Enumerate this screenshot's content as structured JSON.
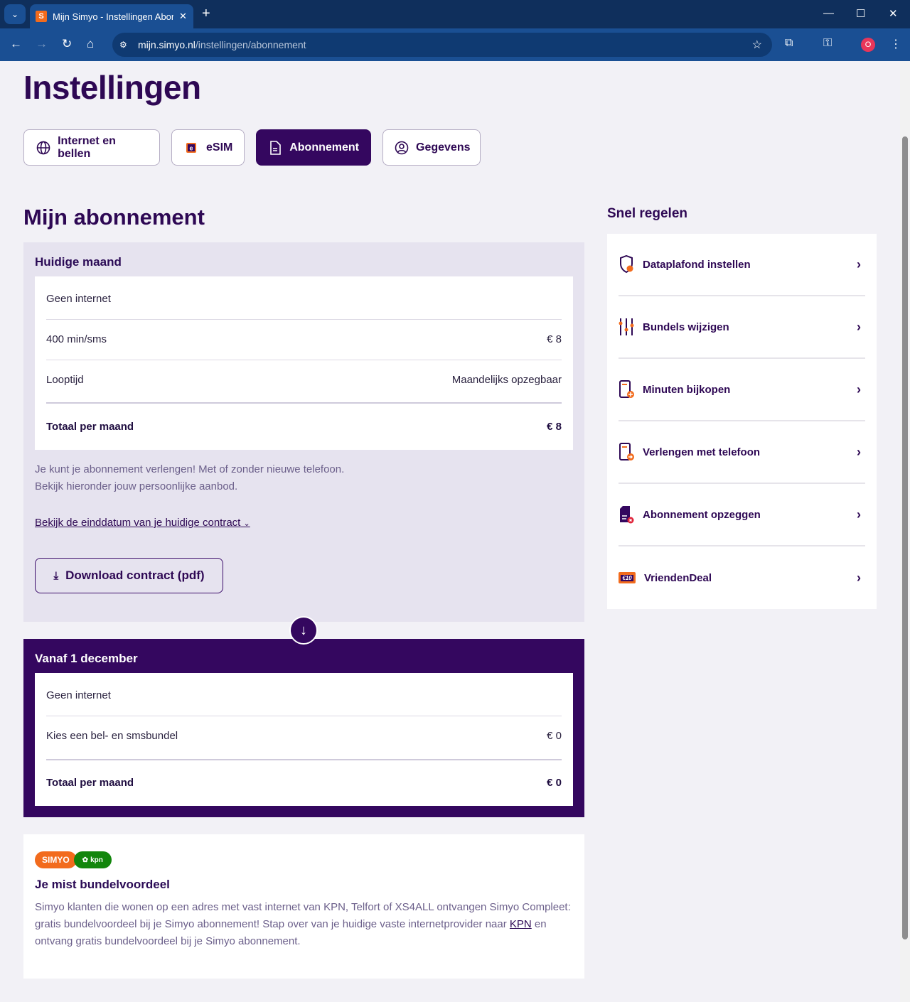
{
  "browser": {
    "tab_title": "Mijn Simyo - Instellingen Abonn",
    "url_host": "mijn.simyo.nl",
    "url_path": "/instellingen/abonnement",
    "profile_badge": "O"
  },
  "page": {
    "title": "Instellingen"
  },
  "tabs": [
    {
      "label": "Internet en bellen"
    },
    {
      "label": "eSIM"
    },
    {
      "label": "Abonnement"
    },
    {
      "label": "Gegevens"
    }
  ],
  "subscription": {
    "title": "Mijn abonnement",
    "current": {
      "title": "Huidige maand",
      "rows": [
        {
          "label": "Geen internet",
          "value": ""
        },
        {
          "label": "400 min/sms",
          "value": "€ 8"
        },
        {
          "label": "Looptijd",
          "value": "Maandelijks opzegbaar"
        }
      ],
      "total_label": "Totaal per maand",
      "total_value": "€ 8"
    },
    "info_line1": "Je kunt je abonnement verlengen! Met of zonder nieuwe telefoon.",
    "info_line2": "Bekijk hieronder jouw persoonlijke aanbod.",
    "end_date_link": "Bekijk de einddatum van je huidige contract",
    "download_label": "Download contract (pdf)",
    "future": {
      "title": "Vanaf 1 december",
      "rows": [
        {
          "label": "Geen internet",
          "value": ""
        },
        {
          "label": "Kies een bel- en smsbundel",
          "value": "€ 0"
        }
      ],
      "total_label": "Totaal per maand",
      "total_value": "€ 0"
    }
  },
  "promo": {
    "logo_simyo": "SIMYO",
    "logo_kpn": "kpn",
    "title": "Je mist bundelvoordeel",
    "text_before": "Simyo klanten die wonen op een adres met vast internet van KPN, Telfort of XS4ALL ontvangen Simyo Compleet: gratis bundelvoordeel bij je Simyo abonnement! Stap over van je huidige vaste internetprovider naar ",
    "link": "KPN",
    "text_after": " en ontvang gratis bundelvoordeel bij je Simyo abonnement."
  },
  "quick": {
    "title": "Snel regelen",
    "items": [
      {
        "label": "Dataplafond instellen",
        "icon": "shield-icon"
      },
      {
        "label": "Bundels wijzigen",
        "icon": "sliders-icon"
      },
      {
        "label": "Minuten bijkopen",
        "icon": "phone-plus-icon"
      },
      {
        "label": "Verlengen met telefoon",
        "icon": "phone-arrow-icon"
      },
      {
        "label": "Abonnement opzeggen",
        "icon": "document-cancel-icon"
      },
      {
        "label": "VriendenDeal",
        "icon": "voucher-icon",
        "badge": "€10"
      }
    ]
  },
  "colors": {
    "brand_purple": "#34075f",
    "brand_orange": "#f26b1d",
    "kpn_green": "#12860c"
  }
}
